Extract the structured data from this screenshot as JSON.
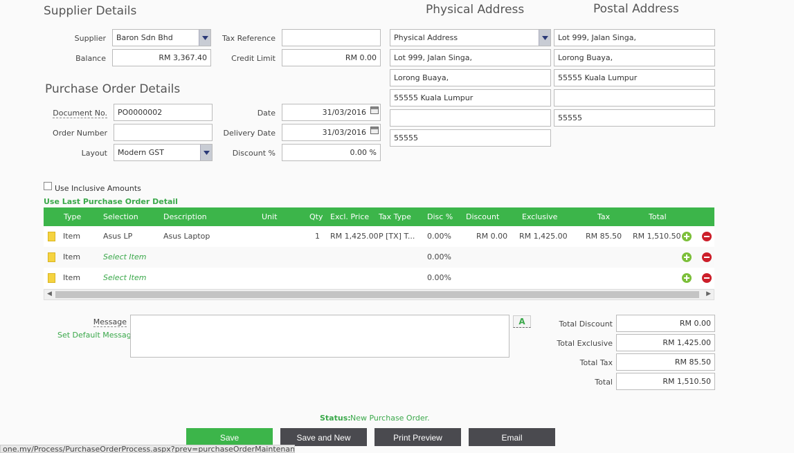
{
  "headings": {
    "supplier_details": "Supplier Details",
    "physical_address": "Physical Address",
    "postal_address": "Postal Address",
    "purchase_order_details": "Purchase Order Details"
  },
  "supplier": {
    "supplier_label": "Supplier",
    "supplier_value": "Baron Sdn Bhd",
    "balance_label": "Balance",
    "balance_value": "RM 3,367.40",
    "tax_ref_label": "Tax Reference",
    "tax_ref_value": "",
    "credit_limit_label": "Credit Limit",
    "credit_limit_value": "RM 0.00"
  },
  "physical": {
    "type_value": "Physical Address",
    "line1": "Lot 999, Jalan Singa,",
    "line2": "Lorong Buaya,",
    "line3": "55555 Kuala Lumpur",
    "line4": "",
    "postcode": "55555"
  },
  "postal": {
    "line1": "Lot 999, Jalan Singa,",
    "line2": "Lorong Buaya,",
    "line3": "55555 Kuala Lumpur",
    "line4": "",
    "postcode": "55555"
  },
  "po": {
    "doc_no_label": "Document No.",
    "doc_no_value": "PO0000002",
    "order_number_label": "Order Number",
    "order_number_value": "",
    "layout_label": "Layout",
    "layout_value": "Modern GST",
    "date_label": "Date",
    "date_value": "31/03/2016",
    "delivery_date_label": "Delivery Date",
    "delivery_date_value": "31/03/2016",
    "discount_label": "Discount %",
    "discount_value": "0.00 %"
  },
  "options": {
    "inclusive_label": "Use Inclusive Amounts",
    "last_po_link": "Use Last Purchase Order Detail"
  },
  "grid": {
    "headers": {
      "type": "Type",
      "selection": "Selection",
      "description": "Description",
      "unit": "Unit",
      "qty": "Qty",
      "excl_price": "Excl. Price",
      "tax_type": "Tax Type",
      "disc": "Disc %",
      "discount": "Discount",
      "exclusive": "Exclusive",
      "tax": "Tax",
      "total": "Total"
    },
    "rows": [
      {
        "type": "Item",
        "selection": "Asus LP",
        "description": "Asus Laptop",
        "unit": "",
        "qty": "1",
        "excl_price": "RM 1,425.00",
        "tax_type": "P [TX] T...",
        "disc": "0.00%",
        "discount": "RM 0.00",
        "exclusive": "RM 1,425.00",
        "tax": "RM 85.50",
        "total": "RM 1,510.50"
      },
      {
        "type": "Item",
        "selection": "Select Item",
        "description": "",
        "unit": "",
        "qty": "",
        "excl_price": "",
        "tax_type": "",
        "disc": "0.00%",
        "discount": "",
        "exclusive": "",
        "tax": "",
        "total": ""
      },
      {
        "type": "Item",
        "selection": "Select Item",
        "description": "",
        "unit": "",
        "qty": "",
        "excl_price": "",
        "tax_type": "",
        "disc": "0.00%",
        "discount": "",
        "exclusive": "",
        "tax": "",
        "total": ""
      }
    ]
  },
  "message": {
    "label": "Message",
    "default_link": "Set Default Message",
    "value": "",
    "font_icon_glyph": "A"
  },
  "totals": {
    "discount_label": "Total Discount",
    "discount_value": "RM 0.00",
    "exclusive_label": "Total Exclusive",
    "exclusive_value": "RM 1,425.00",
    "tax_label": "Total Tax",
    "tax_value": "RM 85.50",
    "total_label": "Total",
    "total_value": "RM 1,510.50"
  },
  "status": {
    "label": "Status:",
    "value": "New Purchase Order."
  },
  "buttons": {
    "save": "Save",
    "save_new": "Save and New",
    "print_preview": "Print Preview",
    "email": "Email"
  },
  "statusbar_url": "one.my/Process/PurchaseOrderProcess.aspx?prev=purchaseOrderMaintenance#",
  "colors": {
    "accent_green": "#3cb54a",
    "dark_button": "#4a4a4f",
    "remove_red": "#cc1f2a"
  }
}
